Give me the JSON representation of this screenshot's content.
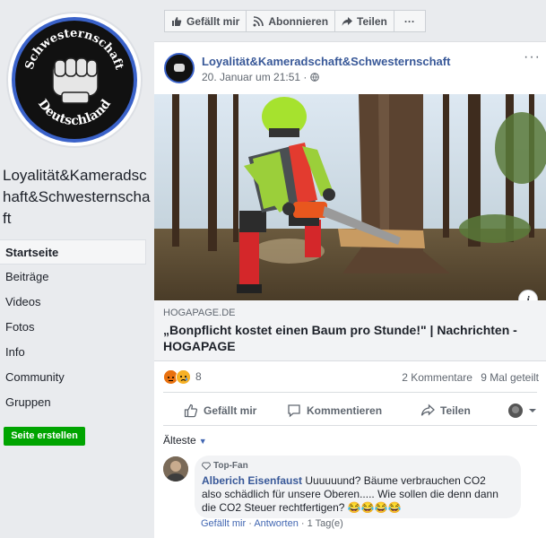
{
  "sidebar": {
    "page_name": "Loyalität&Kameradschaft&Schwesternschaft",
    "logo_top_text": "Schwesternschaft",
    "logo_bottom_text": "Deutschland",
    "nav": [
      {
        "label": "Startseite",
        "active": true
      },
      {
        "label": "Beiträge"
      },
      {
        "label": "Videos"
      },
      {
        "label": "Fotos"
      },
      {
        "label": "Info"
      },
      {
        "label": "Community"
      },
      {
        "label": "Gruppen"
      }
    ],
    "create_button": "Seite erstellen"
  },
  "actionbar": {
    "like": "Gefällt mir",
    "follow": "Abonnieren",
    "share": "Teilen",
    "more": "···"
  },
  "post": {
    "author": "Loyalität&Kameradschaft&Schwesternschaft",
    "time": "20. Januar um 21:51 · ",
    "more": "···",
    "link": {
      "domain": "HOGAPAGE.DE",
      "title": "„Bonpflicht kostet einen Baum pro Stunde!\" | Nachrichten - HOGAPAGE"
    },
    "info_icon": "i",
    "reactions": {
      "count": "8",
      "types": [
        "angry",
        "sad"
      ]
    },
    "comments_count": "2 Kommentare",
    "shares_count": "9 Mal geteilt",
    "actions": {
      "like": "Gefällt mir",
      "comment": "Kommentieren",
      "share": "Teilen"
    }
  },
  "comments": {
    "sort_label": "Älteste",
    "items": [
      {
        "badge": "Top-Fan",
        "author": "Alberich Eisenfaust",
        "text": "Uuuuuund? Bäume verbrauchen CO2 also schädlich für unsere Oberen..... Wie sollen die denn dann die CO2 Steuer rechtfertigen? 😂😂😂😂",
        "like": "Gefällt mir",
        "reply": "Antworten",
        "time": "1 Tag(e)"
      }
    ]
  },
  "colors": {
    "brand_blue": "#4267b2",
    "link_blue": "#385898",
    "green_button": "#00a400",
    "background": "#e9ebee"
  }
}
